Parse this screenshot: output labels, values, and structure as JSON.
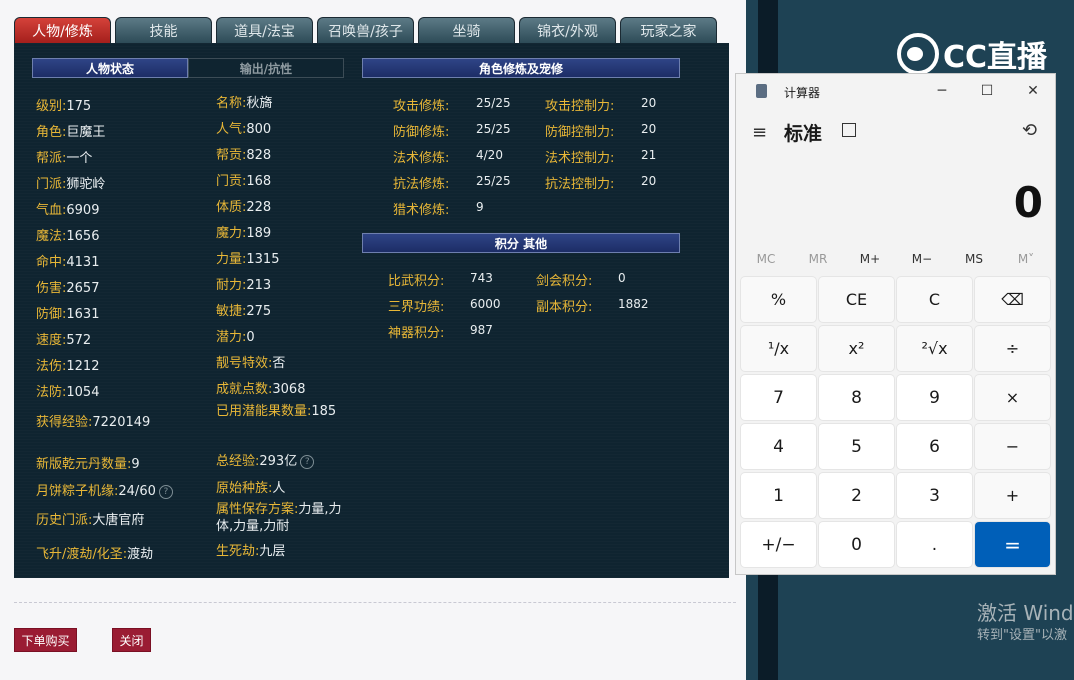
{
  "tabs": [
    "人物/修炼",
    "技能",
    "道具/法宝",
    "召唤兽/孩子",
    "坐骑",
    "锦衣/外观",
    "玩家之家"
  ],
  "section_headers": {
    "status": "人物状态",
    "output": "输出/抗性",
    "cultivation": "角色修炼及宠修",
    "points": "积分 其他"
  },
  "left_col": [
    {
      "label": "级别:",
      "value": "175"
    },
    {
      "label": "角色:",
      "value": "巨魔王"
    },
    {
      "label": "帮派:",
      "value": "一个"
    },
    {
      "label": "门派:",
      "value": "狮驼岭"
    },
    {
      "label": "气血:",
      "value": "6909"
    },
    {
      "label": "魔法:",
      "value": "1656"
    },
    {
      "label": "命中:",
      "value": "4131"
    },
    {
      "label": "伤害:",
      "value": "2657"
    },
    {
      "label": "防御:",
      "value": "1631"
    },
    {
      "label": "速度:",
      "value": "572"
    },
    {
      "label": "法伤:",
      "value": "1212"
    },
    {
      "label": "法防:",
      "value": "1054"
    },
    {
      "label": "获得经验:",
      "value": "7220149"
    },
    {
      "label": "新版乾元丹数量:",
      "value": "9"
    },
    {
      "label": "月饼粽子机缘:",
      "value": "24/60"
    },
    {
      "label": "历史门派:",
      "value": "大唐官府"
    },
    {
      "label": "飞升/渡劫/化圣:",
      "value": "渡劫"
    }
  ],
  "mid_col": [
    {
      "label": "名称:",
      "value": "秋旖"
    },
    {
      "label": "人气:",
      "value": "800"
    },
    {
      "label": "帮贡:",
      "value": "828"
    },
    {
      "label": "门贡:",
      "value": "168"
    },
    {
      "label": "体质:",
      "value": "228"
    },
    {
      "label": "魔力:",
      "value": "189"
    },
    {
      "label": "力量:",
      "value": "1315"
    },
    {
      "label": "耐力:",
      "value": "213"
    },
    {
      "label": "敏捷:",
      "value": "275"
    },
    {
      "label": "潜力:",
      "value": "0"
    },
    {
      "label": "靓号特效:",
      "value": "否"
    },
    {
      "label": "成就点数:",
      "value": "3068"
    },
    {
      "label": "已用潜能果数量:",
      "value": "185"
    },
    {
      "label": "总经验:",
      "value": "293亿"
    },
    {
      "label": "原始种族:",
      "value": "人"
    },
    {
      "label": "属性保存方案:",
      "value": "力量,力体,力量,力耐"
    },
    {
      "label": "生死劫:",
      "value": "九层"
    }
  ],
  "cultivation": [
    {
      "label": "攻击修炼:",
      "value": "25/25",
      "label2": "攻击控制力:",
      "value2": "20"
    },
    {
      "label": "防御修炼:",
      "value": "25/25",
      "label2": "防御控制力:",
      "value2": "20"
    },
    {
      "label": "法术修炼:",
      "value": "4/20",
      "label2": "法术控制力:",
      "value2": "21"
    },
    {
      "label": "抗法修炼:",
      "value": "25/25",
      "label2": "抗法控制力:",
      "value2": "20"
    },
    {
      "label": "猎术修炼:",
      "value": "9",
      "label2": "",
      "value2": ""
    }
  ],
  "points": [
    {
      "label": "比武积分:",
      "value": "743",
      "label2": "剑会积分:",
      "value2": "0"
    },
    {
      "label": "三界功绩:",
      "value": "6000",
      "label2": "副本积分:",
      "value2": "1882"
    },
    {
      "label": "神器积分:",
      "value": "987",
      "label2": "",
      "value2": ""
    }
  ],
  "buttons": {
    "buy": "下单购买",
    "close": "关闭"
  },
  "stream_logo": "CC直播",
  "watermark": {
    "line1": "激活 Wind",
    "line2": "转到\"设置\"以激"
  },
  "calculator": {
    "title": "计算器",
    "mode": "标准",
    "display": "0",
    "memory": [
      "MC",
      "MR",
      "M+",
      "M−",
      "MS",
      "M˅"
    ],
    "keys": [
      "%",
      "CE",
      "C",
      "⌫",
      "¹/x",
      "x²",
      "²√x",
      "÷",
      "7",
      "8",
      "9",
      "×",
      "4",
      "5",
      "6",
      "−",
      "1",
      "2",
      "3",
      "+",
      "+/−",
      "0",
      ".",
      "="
    ]
  }
}
